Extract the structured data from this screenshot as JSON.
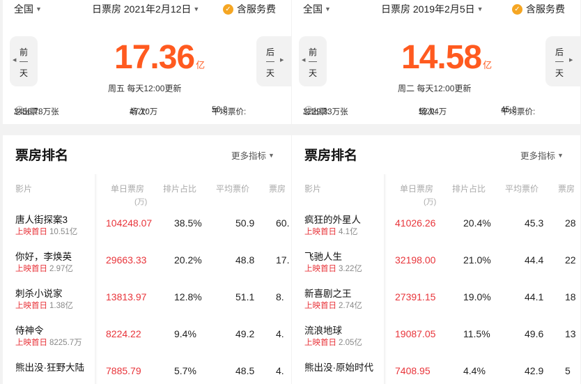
{
  "ui": {
    "region": "全国",
    "fee_label": "含服务费",
    "prev_top": "前",
    "prev_bottom": "天",
    "next_top": "后",
    "next_bottom": "天",
    "unit": "亿",
    "rank_title": "票房排名",
    "more_label": "更多指标",
    "release_tag": "上映首日",
    "columns": {
      "film": "影片",
      "daily": "单日票房",
      "daily_unit": "(万)",
      "share": "排片占比",
      "avg": "平均票价",
      "cut": "票房"
    },
    "stat_labels": {
      "total": "总出票:",
      "shows": "场次:",
      "avg": "平均票价:"
    }
  },
  "panels": [
    {
      "date": "日票房 2021年2月12日",
      "total": "17.36",
      "update": "周五 每天12:00更新",
      "tickets": "3456.78万张",
      "shows": "47.10万",
      "avg_price": "50.2",
      "rows": [
        {
          "name": "唐人街探案3",
          "release": "10.51亿",
          "daily": "104248.07",
          "share": "38.5%",
          "avg": "50.9",
          "cut": "60."
        },
        {
          "name": "你好，李焕英",
          "release": "2.97亿",
          "daily": "29663.33",
          "share": "20.2%",
          "avg": "48.8",
          "cut": "17."
        },
        {
          "name": "刺杀小说家",
          "release": "1.38亿",
          "daily": "13813.97",
          "share": "12.8%",
          "avg": "51.1",
          "cut": "8."
        },
        {
          "name": "侍神令",
          "release": "8225.7万",
          "daily": "8224.22",
          "share": "9.4%",
          "avg": "49.2",
          "cut": "4."
        },
        {
          "name": "熊出没·狂野大陆",
          "release": "",
          "daily": "7885.79",
          "share": "5.7%",
          "avg": "48.5",
          "cut": "4."
        }
      ]
    },
    {
      "date": "日票房 2019年2月5日",
      "total": "14.58",
      "update": "周二 每天12:00更新",
      "tickets": "3229.33万张",
      "shows": "52.04万",
      "avg_price": "45.2",
      "rows": [
        {
          "name": "疯狂的外星人",
          "release": "4.1亿",
          "daily": "41026.26",
          "share": "20.4%",
          "avg": "45.3",
          "cut": "28"
        },
        {
          "name": "飞驰人生",
          "release": "3.22亿",
          "daily": "32198.00",
          "share": "21.0%",
          "avg": "44.4",
          "cut": "22"
        },
        {
          "name": "新喜剧之王",
          "release": "2.74亿",
          "daily": "27391.15",
          "share": "19.0%",
          "avg": "44.1",
          "cut": "18"
        },
        {
          "name": "流浪地球",
          "release": "2.05亿",
          "daily": "19087.05",
          "share": "11.5%",
          "avg": "49.6",
          "cut": "13"
        },
        {
          "name": "熊出没·原始时代",
          "release": "",
          "daily": "7408.95",
          "share": "4.4%",
          "avg": "42.9",
          "cut": "5"
        }
      ]
    }
  ],
  "colors": {
    "accent_orange": "#ff5a1f",
    "red": "#e8343a",
    "check_orange": "#f5a623"
  }
}
